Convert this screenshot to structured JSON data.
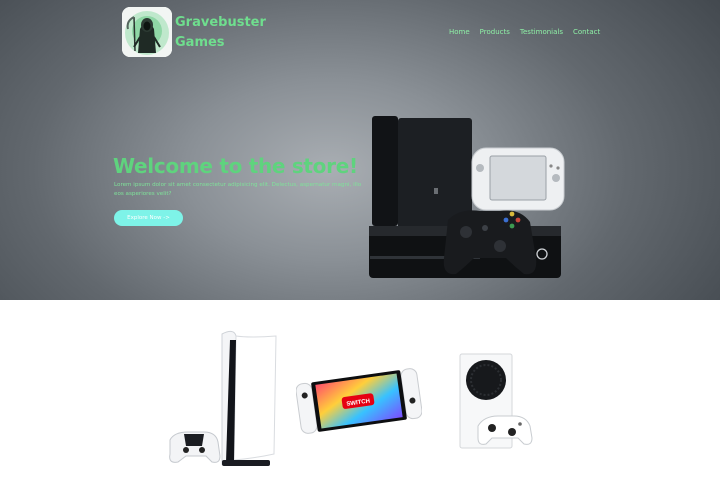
{
  "brand": {
    "line1": "Gravebuster",
    "line2": "Games",
    "logo_icon": "reaper-logo-icon",
    "accent": "#6fde8e"
  },
  "nav": {
    "items": [
      "Home",
      "Products",
      "Testimonials",
      "Contact"
    ]
  },
  "hero": {
    "title": "Welcome to the store!",
    "text": "Lorem ipsum dolor sit amet consectetur adipisicing elit. Delectus, aspernatur magni, illo eos asperiores velit?",
    "cta_label": "Explore Now ->",
    "cta_color": "#7ef3e8",
    "image": "game-consoles-icon"
  },
  "products": [
    {
      "icon": "playstation-5-icon"
    },
    {
      "icon": "nintendo-switch-icon"
    },
    {
      "icon": "xbox-series-s-icon"
    }
  ]
}
